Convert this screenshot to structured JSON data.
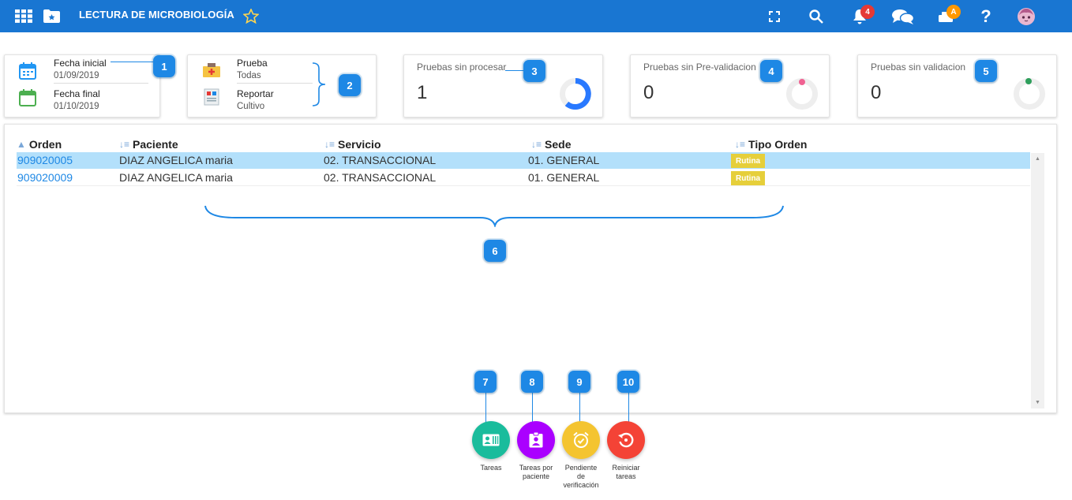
{
  "header": {
    "title": "LECTURA DE MICROBIOLOGÍA",
    "notifications_count": "4",
    "user_initial": "A",
    "icons": [
      "apps-grid-icon",
      "folder-star-icon",
      "star-icon",
      "fullscreen-icon",
      "search-icon",
      "bell-icon",
      "chat-icon",
      "users-icon",
      "help-icon",
      "avatar"
    ]
  },
  "filters": {
    "fecha_inicial_label": "Fecha inicial",
    "fecha_inicial_value": "01/09/2019",
    "fecha_final_label": "Fecha final",
    "fecha_final_value": "01/10/2019",
    "prueba_label": "Prueba",
    "prueba_value": "Todas",
    "reportar_label": "Reportar",
    "reportar_value": "Cultivo"
  },
  "stats": [
    {
      "title": "Pruebas sin procesar",
      "value": "1",
      "dot_color": "#2979ff"
    },
    {
      "title": "Pruebas sin Pre-validacion",
      "value": "0",
      "dot_color": "#f06292"
    },
    {
      "title": "Pruebas sin validacion",
      "value": "0",
      "dot_color": "#2e9e5b"
    }
  ],
  "table": {
    "headers": [
      "Orden",
      "Paciente",
      "Servicio",
      "Sede",
      "Tipo Orden"
    ],
    "rows": [
      {
        "orden": "909020005",
        "paciente": "DIAZ ANGELICA maria",
        "servicio": "02. TRANSACCIONAL",
        "sede": "01. GENERAL",
        "tipo": "Rutina",
        "selected": true
      },
      {
        "orden": "909020009",
        "paciente": "DIAZ ANGELICA maria",
        "servicio": "02. TRANSACCIONAL",
        "sede": "01. GENERAL",
        "tipo": "Rutina",
        "selected": false
      }
    ]
  },
  "callouts": [
    "1",
    "2",
    "3",
    "4",
    "5",
    "6",
    "7",
    "8",
    "9",
    "10"
  ],
  "actions": [
    {
      "label_line1": "Tareas",
      "label_line2": "",
      "label_line3": "",
      "color": "#1abc9c"
    },
    {
      "label_line1": "Tareas por",
      "label_line2": "paciente",
      "label_line3": "",
      "color": "#aa00ff"
    },
    {
      "label_line1": "Pendiente",
      "label_line2": "de",
      "label_line3": "verificación",
      "color": "#f4c430"
    },
    {
      "label_line1": "Reiniciar",
      "label_line2": "tareas",
      "label_line3": "",
      "color": "#f44336"
    }
  ]
}
